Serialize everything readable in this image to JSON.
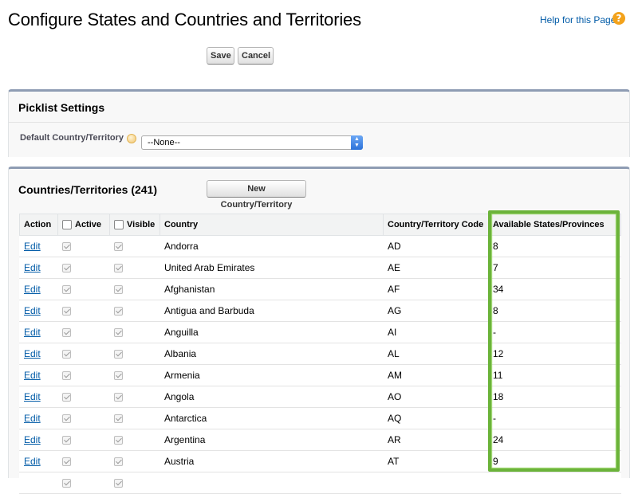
{
  "page": {
    "title": "Configure States and Countries and Territories",
    "help_link": "Help for this Page"
  },
  "toolbar": {
    "save_label": "Save",
    "cancel_label": "Cancel"
  },
  "picklist_settings": {
    "title": "Picklist Settings",
    "default_label": "Default Country/Territory",
    "default_value": "--None--"
  },
  "countries": {
    "title": "Countries/Territories (241)",
    "new_button": "New Country/Territory",
    "columns": {
      "action": "Action",
      "active": "Active",
      "visible": "Visible",
      "country": "Country",
      "code": "Country/Territory Code",
      "states": "Available States/Provinces"
    },
    "rows": [
      {
        "action": "Edit",
        "active": true,
        "visible": true,
        "name": "Andorra",
        "code": "AD",
        "states": "8"
      },
      {
        "action": "Edit",
        "active": true,
        "visible": true,
        "name": "United Arab Emirates",
        "code": "AE",
        "states": "7"
      },
      {
        "action": "Edit",
        "active": true,
        "visible": true,
        "name": "Afghanistan",
        "code": "AF",
        "states": "34"
      },
      {
        "action": "Edit",
        "active": true,
        "visible": true,
        "name": "Antigua and Barbuda",
        "code": "AG",
        "states": "8"
      },
      {
        "action": "Edit",
        "active": true,
        "visible": true,
        "name": "Anguilla",
        "code": "AI",
        "states": "-"
      },
      {
        "action": "Edit",
        "active": true,
        "visible": true,
        "name": "Albania",
        "code": "AL",
        "states": "12"
      },
      {
        "action": "Edit",
        "active": true,
        "visible": true,
        "name": "Armenia",
        "code": "AM",
        "states": "11"
      },
      {
        "action": "Edit",
        "active": true,
        "visible": true,
        "name": "Angola",
        "code": "AO",
        "states": "18"
      },
      {
        "action": "Edit",
        "active": true,
        "visible": true,
        "name": "Antarctica",
        "code": "AQ",
        "states": "-"
      },
      {
        "action": "Edit",
        "active": true,
        "visible": true,
        "name": "Argentina",
        "code": "AR",
        "states": "24"
      },
      {
        "action": "Edit",
        "active": true,
        "visible": true,
        "name": "Austria",
        "code": "AT",
        "states": "9"
      },
      {
        "action": "",
        "active": true,
        "visible": true,
        "name": "",
        "code": "",
        "states": ""
      }
    ]
  },
  "colors": {
    "link": "#015ba7",
    "section_border": "#8e9cb3",
    "highlight": "#6bb33a",
    "help_icon": "#f3a21b"
  }
}
